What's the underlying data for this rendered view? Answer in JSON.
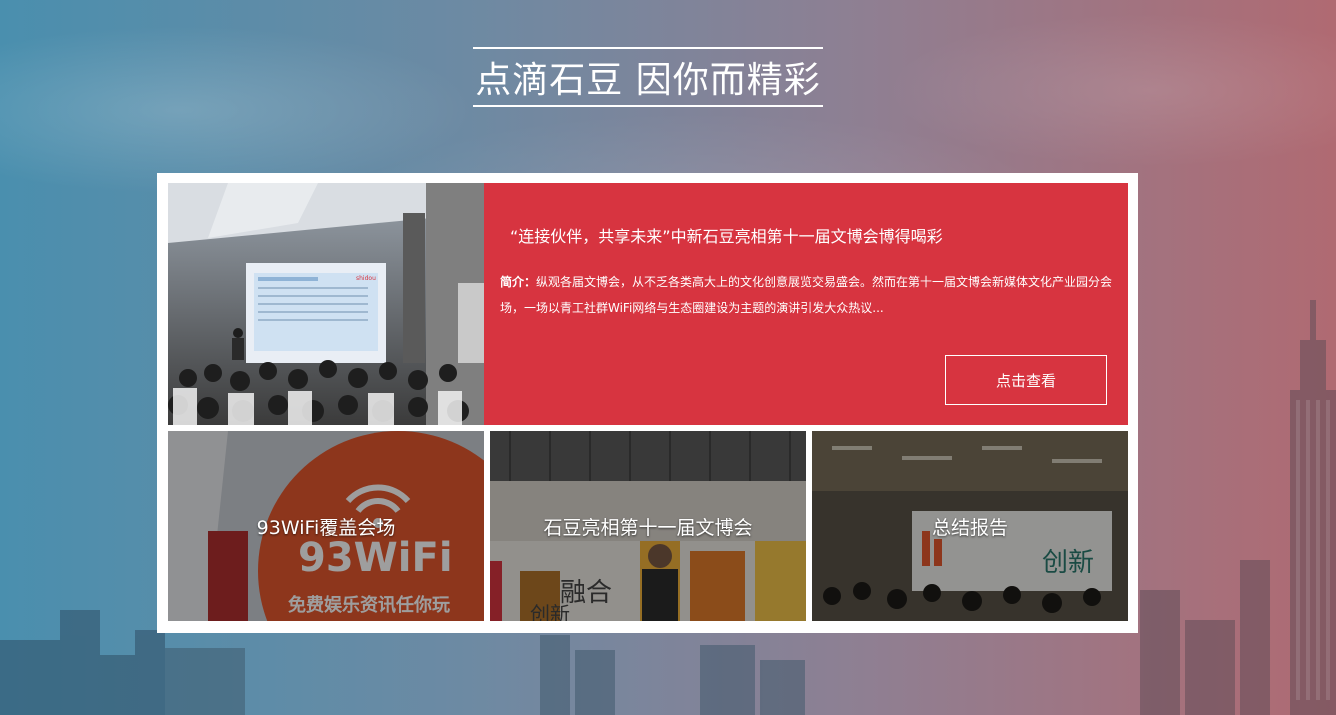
{
  "header": {
    "title": "点滴石豆 因你而精彩"
  },
  "feature": {
    "title": "“连接伙伴，共享未来”中新石豆亮相第十一届文博会博得喝彩",
    "summary_label": "简介：",
    "summary_text": "纵观各届文博会，从不乏各类高大上的文化创意展览交易盛会。然而在第十一届文博会新媒体文化产业园分会场，一场以青工社群WiFi网络与生态圈建设为主题的演讲引发大众热议...",
    "button_label": "点击查看",
    "slide_brand_text": "shidou"
  },
  "thumbnails": [
    {
      "label": "93WiFi覆盖会场",
      "banner_text": "93WiFi",
      "banner_subtext": "免费娱乐资讯任你玩"
    },
    {
      "label": "石豆亮相第十一届文博会",
      "banner_text": "融合",
      "banner_subtext": "创新"
    },
    {
      "label": "总结报告",
      "banner_text": "创新"
    }
  ],
  "colors": {
    "accent_red": "#d73440",
    "panel_bg": "#ffffff",
    "text_light": "#ffffff"
  }
}
